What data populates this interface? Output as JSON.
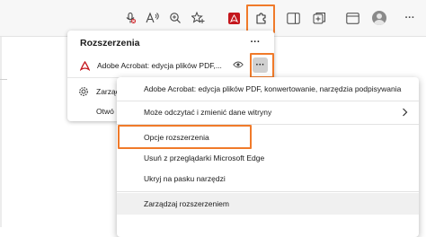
{
  "toolbar": {
    "icons": [
      "mic-muted-icon",
      "read-aloud-icon",
      "zoom-icon",
      "add-favorite-icon",
      "acrobat-icon",
      "extensions-icon",
      "sidebar-icon",
      "collections-icon",
      "tab-icon",
      "profile-icon",
      "more-icon"
    ],
    "highlight_color": "#f07a2a"
  },
  "extensions_panel": {
    "title": "Rozszerzenia",
    "more_label": "···",
    "items": [
      {
        "name": "Adobe Acrobat: edycja plików PDF,...",
        "more_label": "···"
      }
    ],
    "manage_label_truncated": "Zarząc",
    "open_label_truncated": "Otwó"
  },
  "context_menu": {
    "items": [
      {
        "label": "Adobe Acrobat: edycja plików PDF, konwertowanie, narzędzia podpisywania"
      },
      {
        "label": "Może odczytać i zmienić dane witryny"
      },
      {
        "label": "Opcje rozszerzenia"
      },
      {
        "label": "Usuń z przeglądarki Microsoft Edge"
      },
      {
        "label": "Ukryj na pasku narzędzi"
      },
      {
        "label": "Zarządzaj rozszerzeniem"
      }
    ]
  }
}
